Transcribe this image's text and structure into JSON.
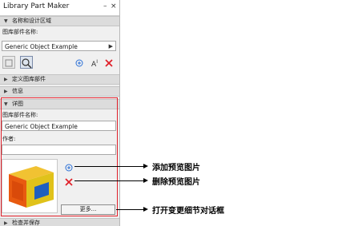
{
  "window": {
    "title": "Library Part Maker"
  },
  "sections": {
    "name_area": "名称和设计区域",
    "define": "定义图库部件",
    "info": "信息",
    "detail": "详图",
    "check": "检查并保存"
  },
  "name_area": {
    "part_name_label": "图库部件名称:",
    "part_name_value": "Generic Object Example"
  },
  "detail": {
    "part_name_label": "图库部件名称:",
    "part_name_value": "Generic Object Example",
    "author_label": "作者:",
    "author_value": "",
    "more_button": "更多..."
  },
  "callouts": {
    "add_preview": "添加预览图片",
    "delete_preview": "删除预览图片",
    "open_details": "打开变更细节对话框"
  },
  "colors": {
    "accent_red": "#e0202a",
    "accent_blue": "#2a6fd6",
    "preview_orange": "#e85a10",
    "preview_yellow": "#e0c21a"
  }
}
